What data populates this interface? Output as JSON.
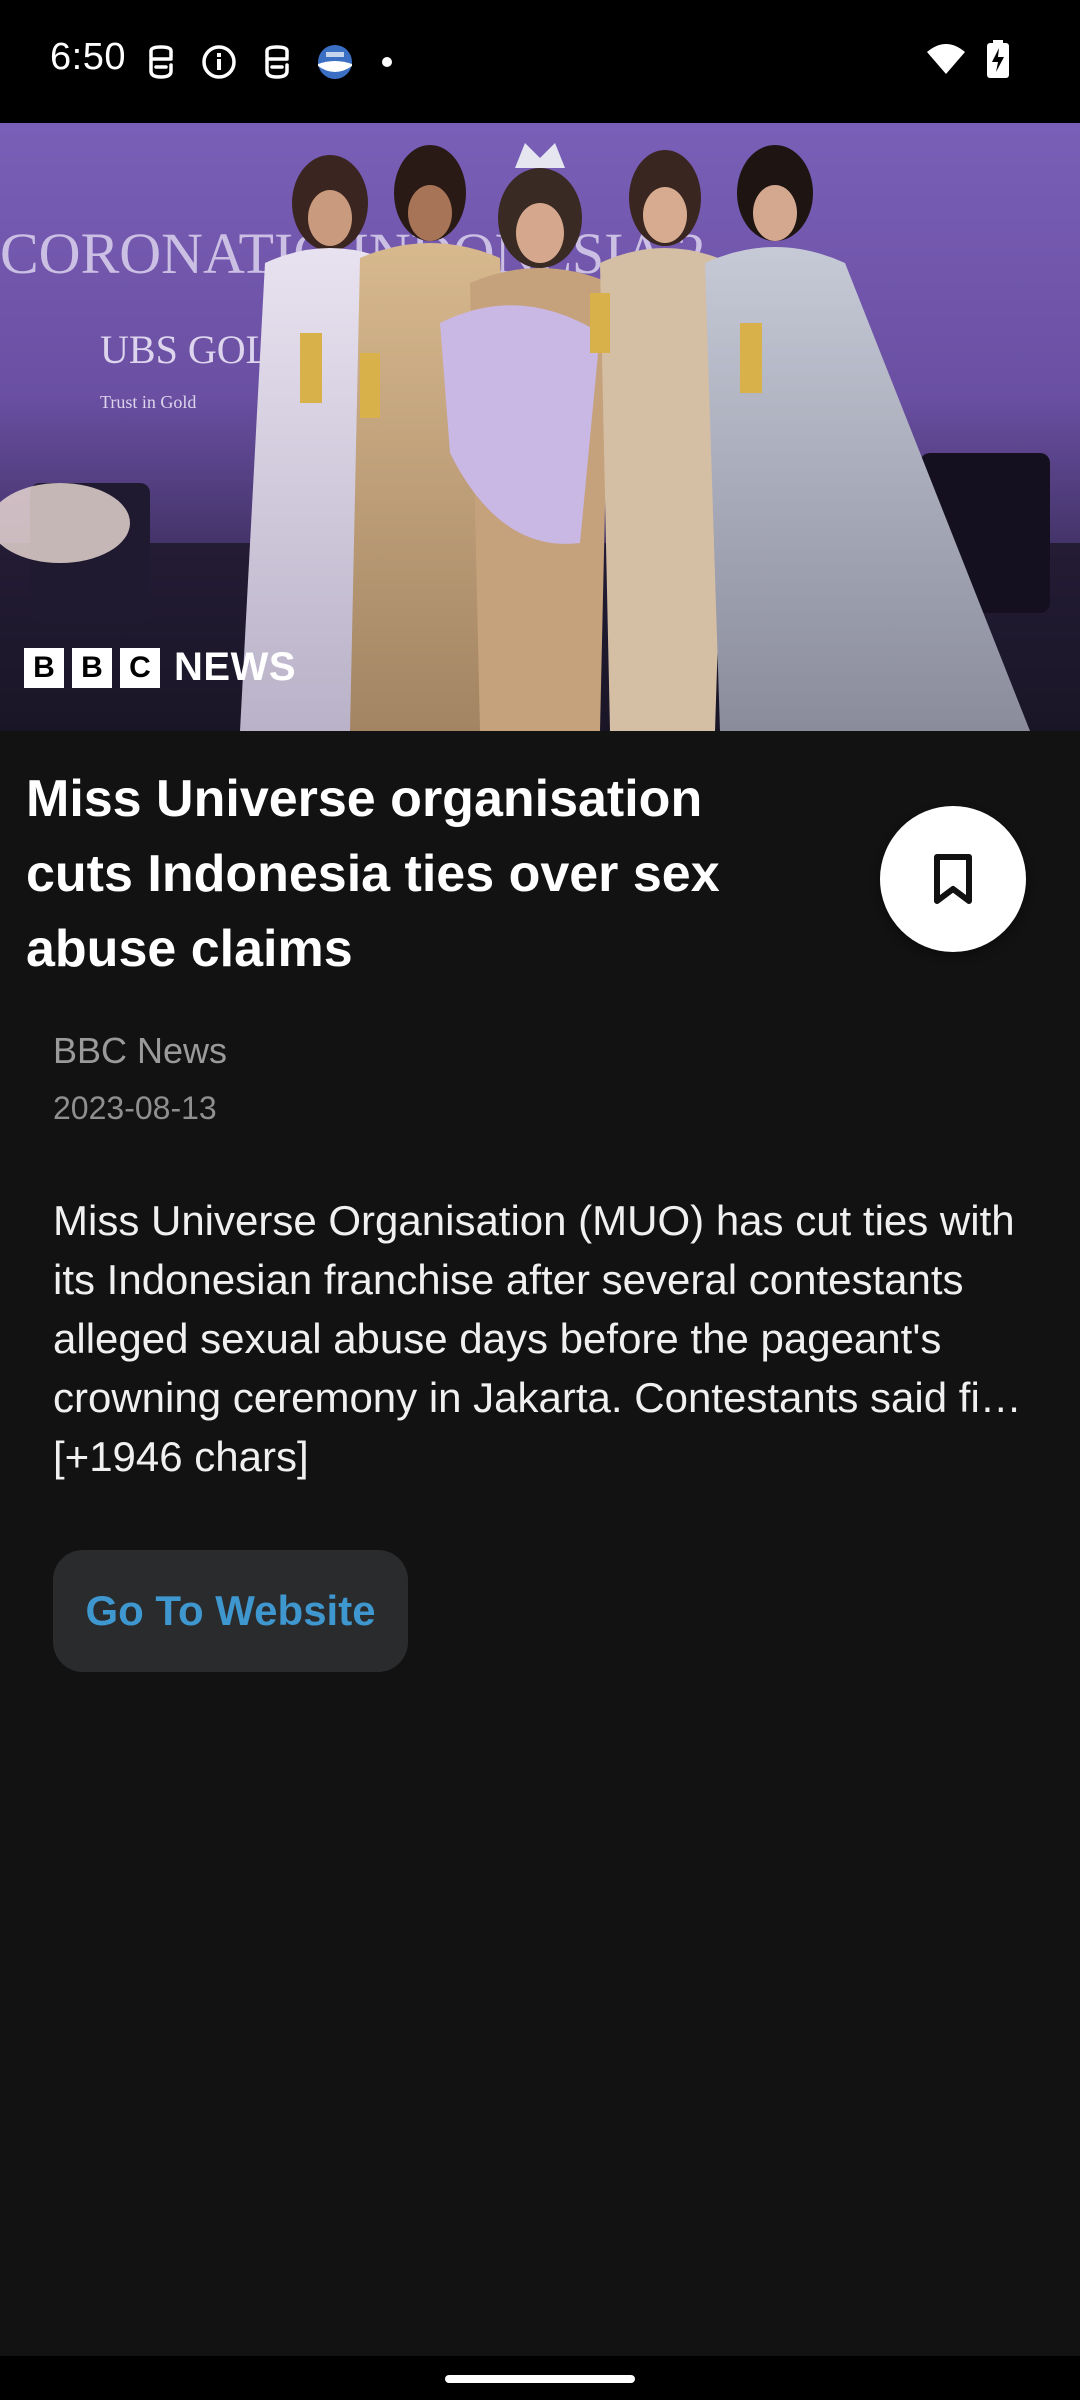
{
  "status_bar": {
    "time": "6:50",
    "left_icons": [
      "notification-icon",
      "info-icon",
      "notification-icon",
      "app-globe-icon",
      "dot-icon"
    ],
    "right_icons": [
      "wifi-icon",
      "battery-charging-icon"
    ]
  },
  "hero": {
    "logo_blocks": [
      "B",
      "B",
      "C"
    ],
    "logo_word": "NEWS",
    "backdrop_text": "CORONATIO          INDONESIA 2",
    "sponsor_text": "UBS GOLD",
    "sponsor_sub": "Trust in Gold"
  },
  "article": {
    "headline": "Miss Universe organisation cuts Indonesia ties over sex abuse claims",
    "source": "BBC News",
    "date": "2023-08-13",
    "body": "Miss Universe Organisation (MUO) has cut ties with its Indonesian franchise after several contestants alleged sexual abuse days before the pageant's crowning ceremony in Jakarta. Contestants said fi… [+1946 chars]",
    "button_label": "Go To Website"
  },
  "colors": {
    "background": "#121212",
    "accent_link": "#3f97cf",
    "button_bg": "#2a2b2d",
    "hero_purple": "#6b4f9e"
  }
}
